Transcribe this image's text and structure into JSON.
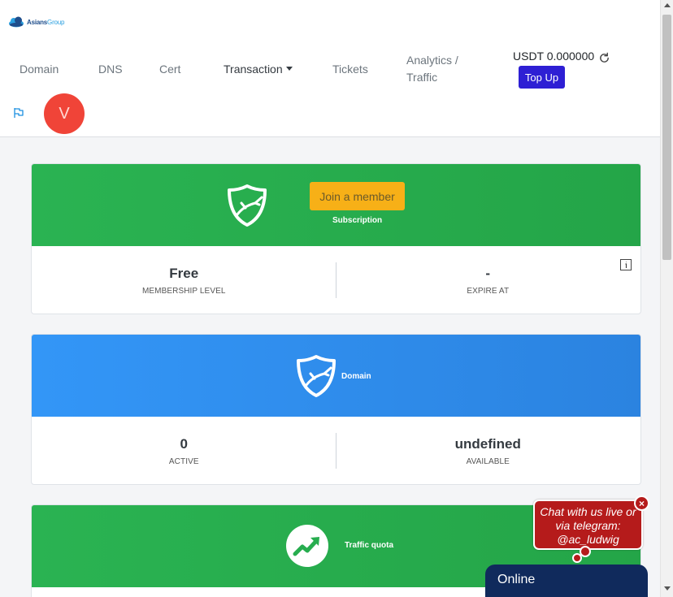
{
  "logo": {
    "part1": "Asians",
    "part2": "Group"
  },
  "nav": {
    "domain": "Domain",
    "dns": "DNS",
    "cert": "Cert",
    "transaction": "Transaction",
    "tickets": "Tickets",
    "analytics_line1": "Analytics /",
    "analytics_line2": "Traffic"
  },
  "wallet": {
    "balance": "USDT 0.000000",
    "topup_label": "Top Up"
  },
  "user": {
    "avatar_initial": "V"
  },
  "subscription": {
    "join_label": "Join a member",
    "caption": "Subscription",
    "level_value": "Free",
    "level_label": "MEMBERSHIP LEVEL",
    "expire_value": "-",
    "expire_label": "EXPIRE AT"
  },
  "domain_card": {
    "caption": "Domain",
    "active_value": "0",
    "active_label": "ACTIVE",
    "available_value": "undefined",
    "available_label": "AVAILABLE"
  },
  "traffic_card": {
    "caption": "Traffic quota"
  },
  "chat": {
    "line1": "Chat with us live or",
    "line2": "via telegram:",
    "line3": "@ac_ludwig",
    "close": "×",
    "status": "Online"
  },
  "colors": {
    "green": "#27ad4f",
    "blue": "#3192f2",
    "primary": "#2e1fd4",
    "warning": "#f7b017",
    "avatar": "#f04438",
    "chat_red": "#b51b1b",
    "chat_navy": "#102a5c"
  }
}
